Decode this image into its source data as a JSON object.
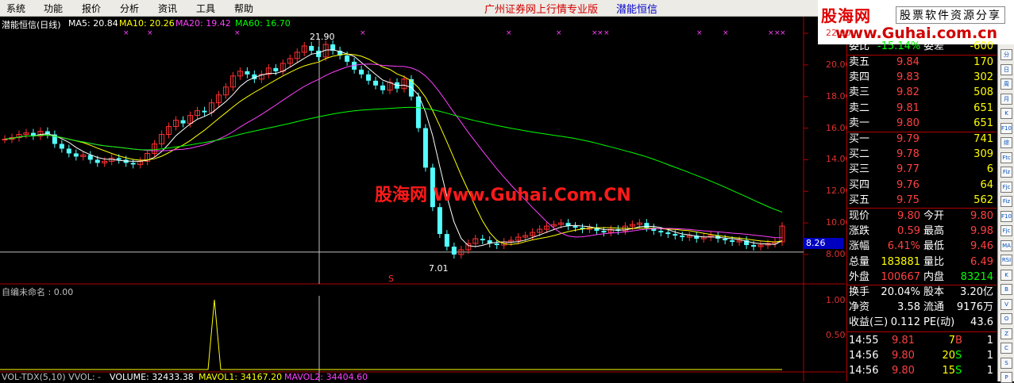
{
  "menu": [
    "系统",
    "功能",
    "报价",
    "分析",
    "资讯",
    "工具",
    "帮助"
  ],
  "banner": {
    "title": "广州证券网上行情专业版",
    "stock": "潜能恒信"
  },
  "logo": {
    "brand": "股海网",
    "slogan": "股票软件资源分享",
    "url": "www.Guhai.com.cn"
  },
  "watermark": "股海网 Www.Guhai.Com.CN",
  "ma_info": {
    "title": "潜能恒信(日线)",
    "ma5": "MA5: 20.84",
    "ma10": "MA10: 20.26",
    "ma20": "MA20: 19.42",
    "ma60": "MA60: 16.70",
    "colors": {
      "title": "#ffffff",
      "ma5": "#ffffff",
      "ma10": "#ffff00",
      "ma20": "#ff40ff",
      "ma60": "#00ff00"
    }
  },
  "price_axis": [
    {
      "label": "22.00",
      "v": 22
    },
    {
      "label": "20.00",
      "v": 20
    },
    {
      "label": "18.00",
      "v": 18
    },
    {
      "label": "16.00",
      "v": 16
    },
    {
      "label": "14.00",
      "v": 14
    },
    {
      "label": "12.00",
      "v": 12
    },
    {
      "label": "10.00",
      "v": 10
    },
    {
      "label": "8.00",
      "v": 8
    }
  ],
  "current_price": "8.26",
  "annotations": {
    "high": "21.90",
    "low": "7.01",
    "s_mark": "S"
  },
  "indicator": {
    "label": "自编未命名 : 0.00",
    "axis": [
      "1.00",
      "0.50"
    ]
  },
  "volume_info": {
    "a": "VOL-TDX(5,10)  VVOL: -",
    "b": "VOLUME: 32433.38",
    "c": "MAVOL1: 34167.20",
    "d": "MAVOL2: 34404.60"
  },
  "quote": {
    "weibi": {
      "l": "委比",
      "v": "-15.14%",
      "l2": "委差",
      "v2": "-600"
    },
    "sell": [
      {
        "l": "卖五",
        "p": "9.84",
        "q": "170"
      },
      {
        "l": "卖四",
        "p": "9.83",
        "q": "302"
      },
      {
        "l": "卖三",
        "p": "9.82",
        "q": "508"
      },
      {
        "l": "卖二",
        "p": "9.81",
        "q": "651"
      },
      {
        "l": "卖一",
        "p": "9.80",
        "q": "651"
      }
    ],
    "buy": [
      {
        "l": "买一",
        "p": "9.79",
        "q": "741"
      },
      {
        "l": "买二",
        "p": "9.78",
        "q": "309"
      },
      {
        "l": "买三",
        "p": "9.77",
        "q": "6"
      },
      {
        "l": "买四",
        "p": "9.76",
        "q": "64"
      },
      {
        "l": "买五",
        "p": "9.75",
        "q": "562"
      }
    ],
    "stats": [
      {
        "l1": "现价",
        "v1": "9.80",
        "l2": "今开",
        "v2": "9.80"
      },
      {
        "l1": "涨跌",
        "v1": "0.59",
        "l2": "最高",
        "v2": "9.98"
      },
      {
        "l1": "涨幅",
        "v1": "6.41%",
        "l2": "最低",
        "v2": "9.46"
      },
      {
        "l1": "总量",
        "v1": "183881",
        "l2": "量比",
        "v2": "6.49"
      },
      {
        "l1": "外盘",
        "v1": "100667",
        "l2": "内盘",
        "v2": "83214"
      }
    ],
    "stats2": [
      {
        "l1": "换手",
        "v1": "20.04%",
        "l2": "股本",
        "v2": "3.20亿"
      },
      {
        "l1": "净资",
        "v1": "3.58",
        "l2": "流通",
        "v2": "9176万"
      },
      {
        "l1": "收益(三)",
        "v1": "0.112",
        "l2": "PE(动)",
        "v2": "43.6"
      }
    ],
    "ticks": [
      {
        "t": "14:55",
        "p": "9.81",
        "q": "7",
        "d": "B",
        "n": "1"
      },
      {
        "t": "14:56",
        "p": "9.80",
        "q": "20",
        "d": "S",
        "n": "1"
      },
      {
        "t": "14:56",
        "p": "9.80",
        "q": "15",
        "d": "S",
        "n": "1"
      }
    ]
  },
  "toolbar": [
    "分",
    "日",
    "周",
    "月",
    "K",
    "F10",
    "综",
    "Ftc",
    "Fiz",
    "Fjc",
    "Fiz",
    "F10",
    "Fjc",
    "MA",
    "RSI",
    "K",
    "B",
    "V",
    "O",
    "Z",
    "C",
    "S",
    "P"
  ]
}
